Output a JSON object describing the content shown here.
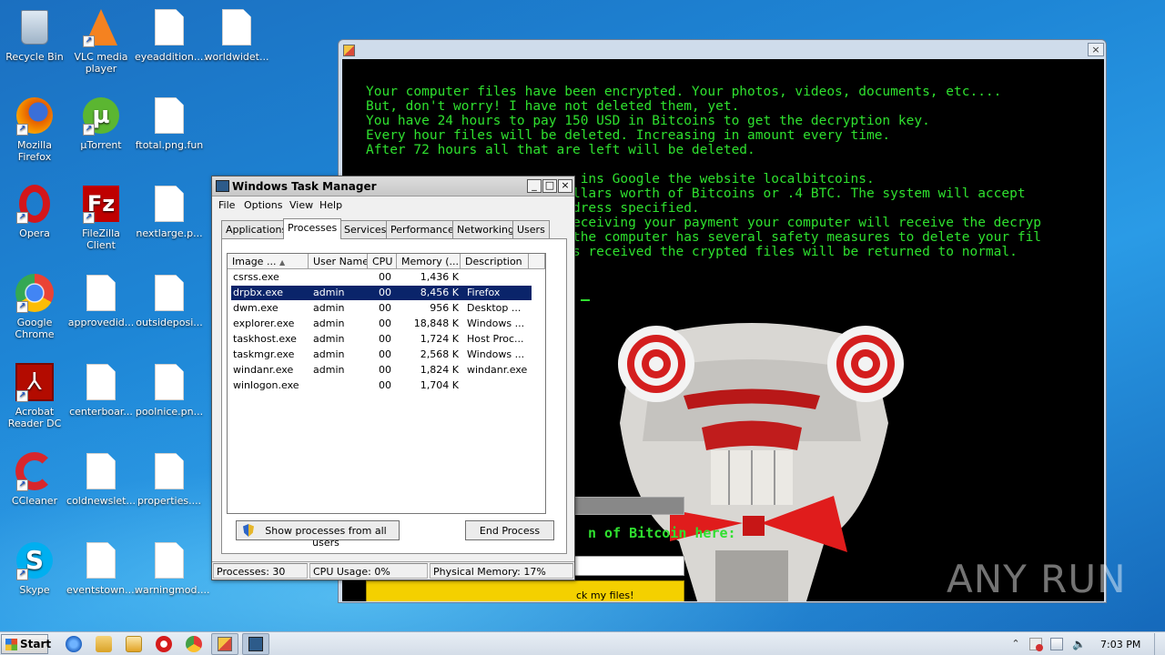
{
  "desktop": {
    "icons": [
      {
        "label": "Recycle Bin",
        "icon": "recycle-bin-icon"
      },
      {
        "label": "VLC media player",
        "icon": "vlc-icon"
      },
      {
        "label": "eyeaddition....",
        "icon": "file-icon"
      },
      {
        "label": "worldwidet...",
        "icon": "file-icon"
      },
      {
        "label": "Mozilla Firefox",
        "icon": "firefox-icon"
      },
      {
        "label": "µTorrent",
        "icon": "utorrent-icon"
      },
      {
        "label": "ftotal.png.fun",
        "icon": "file-icon"
      },
      {
        "label": "Opera",
        "icon": "opera-icon"
      },
      {
        "label": "FileZilla Client",
        "icon": "filezilla-icon"
      },
      {
        "label": "nextlarge.p...",
        "icon": "file-icon"
      },
      {
        "label": "Google Chrome",
        "icon": "chrome-icon"
      },
      {
        "label": "approvedid...",
        "icon": "file-icon"
      },
      {
        "label": "outsideposi...",
        "icon": "file-icon"
      },
      {
        "label": "Acrobat Reader DC",
        "icon": "acrobat-icon"
      },
      {
        "label": "centerboar...",
        "icon": "file-icon"
      },
      {
        "label": "poolnice.pn...",
        "icon": "file-icon"
      },
      {
        "label": "CCleaner",
        "icon": "ccleaner-icon"
      },
      {
        "label": "coldnewslet...",
        "icon": "file-icon"
      },
      {
        "label": "properties....",
        "icon": "file-icon"
      },
      {
        "label": "Skype",
        "icon": "skype-icon"
      },
      {
        "label": "eventstown....",
        "icon": "file-icon"
      },
      {
        "label": "warningmod....",
        "icon": "file-icon"
      }
    ]
  },
  "ransom": {
    "close_label": "×",
    "lines": [
      "Your computer files have been encrypted. Your photos, videos, documents, etc....",
      "But, don't worry! I have not deleted them, yet.",
      "You have 24 hours to pay 150 USD in Bitcoins to get the decryption key.",
      "Every hour files will be deleted. Increasing in amount every time.",
      "After 72 hours all that are left will be deleted.",
      "",
      "                           ins Google the website localbitcoins.",
      "                          llars worth of Bitcoins or .4 BTC. The system will accept",
      "                          dress specified.",
      "                          eceiving your payment your computer will receive the decryp",
      "                          the computer has several safety measures to delete your fil",
      "                          s received the crypted files will be returned to normal."
    ],
    "prompt_text": "n of Bitcoin here:",
    "button_label": "ck my files!"
  },
  "taskmgr": {
    "title": "Windows Task Manager",
    "menu": [
      "File",
      "Options",
      "View",
      "Help"
    ],
    "tabs": [
      "Applications",
      "Processes",
      "Services",
      "Performance",
      "Networking",
      "Users"
    ],
    "active_tab": "Processes",
    "columns": [
      "Image ...",
      "User Name",
      "CPU",
      "Memory (...",
      "Description"
    ],
    "rows": [
      {
        "image": "csrss.exe",
        "user": "",
        "cpu": "00",
        "memory": "1,436 K",
        "desc": ""
      },
      {
        "image": "drpbx.exe",
        "user": "admin",
        "cpu": "00",
        "memory": "8,456 K",
        "desc": "Firefox"
      },
      {
        "image": "dwm.exe",
        "user": "admin",
        "cpu": "00",
        "memory": "956 K",
        "desc": "Desktop ..."
      },
      {
        "image": "explorer.exe",
        "user": "admin",
        "cpu": "00",
        "memory": "18,848 K",
        "desc": "Windows ..."
      },
      {
        "image": "taskhost.exe",
        "user": "admin",
        "cpu": "00",
        "memory": "1,724 K",
        "desc": "Host Proc..."
      },
      {
        "image": "taskmgr.exe",
        "user": "admin",
        "cpu": "00",
        "memory": "2,568 K",
        "desc": "Windows ..."
      },
      {
        "image": "windanr.exe",
        "user": "admin",
        "cpu": "00",
        "memory": "1,824 K",
        "desc": "windanr.exe"
      },
      {
        "image": "winlogon.exe",
        "user": "",
        "cpu": "00",
        "memory": "1,704 K",
        "desc": ""
      }
    ],
    "selected_row": 1,
    "show_all_label": "Show processes from all users",
    "end_process_label": "End Process",
    "status": {
      "processes": "Processes: 30",
      "cpu": "CPU Usage: 0%",
      "memory": "Physical Memory: 17%"
    }
  },
  "taskbar": {
    "start_label": "Start",
    "clock": "7:03 PM"
  },
  "watermark": "ANY RUN"
}
